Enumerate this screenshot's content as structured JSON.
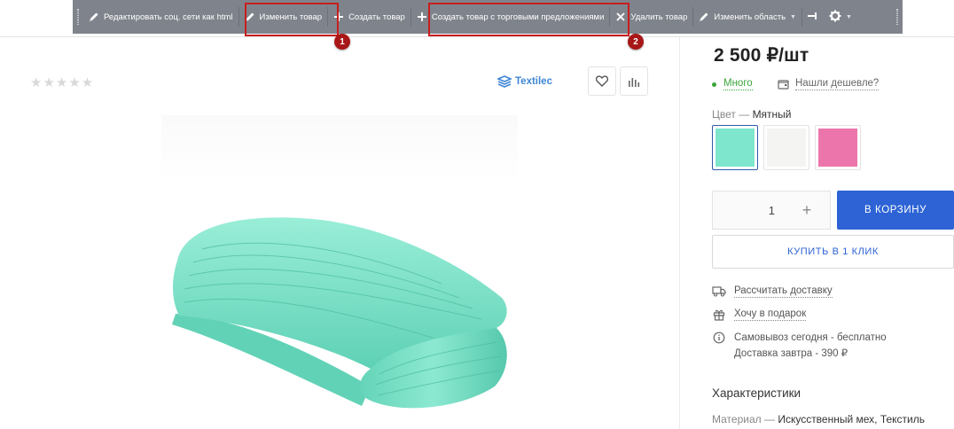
{
  "toolbar": {
    "edit_social_html": "Редактировать соц. сети как html",
    "edit_product": "Изменить товар",
    "create_product": "Создать товар",
    "create_with_offers": "Создать товар с торговыми предложениями",
    "delete_product": "Удалить товар",
    "edit_area": "Изменить область",
    "markers": {
      "first": "1",
      "second": "2"
    },
    "highlight_color": "#c81e1e"
  },
  "product": {
    "rating_stars": "★★★★★",
    "rating_value": 0,
    "brand": "Textilec",
    "price": "2 500 ₽/шт",
    "stock": "Много",
    "cheaper": "Нашли дешевле?",
    "color_label": "Цвет",
    "color_sep": " — ",
    "color_value": "Мятный",
    "swatches": [
      {
        "name": "Мятный",
        "color": "#7ee6cd",
        "selected": true
      },
      {
        "name": "Белый",
        "color": "#f4f4f2",
        "selected": false
      },
      {
        "name": "Розовый",
        "color": "#ec76ab",
        "selected": false
      }
    ],
    "quantity": "1",
    "add_to_cart": "В КОРЗИНУ",
    "buy_one_click": "КУПИТЬ В 1 КЛИК",
    "calc_delivery": "Рассчитать доставку",
    "gift": "Хочу в подарок",
    "pickup": "Самовывоз сегодня - бесплатно",
    "delivery": "Доставка завтра - 390 ₽",
    "characteristics_title": "Характеристики",
    "material_label": "Материал",
    "material_sep": " — ",
    "material_value": "Искусственный мех, Текстиль"
  },
  "colors": {
    "toolbar_bg": "#7f848c",
    "accent_blue": "#2d63d5",
    "stock_green": "#3aa53a",
    "brand_blue": "#3f86d6"
  }
}
